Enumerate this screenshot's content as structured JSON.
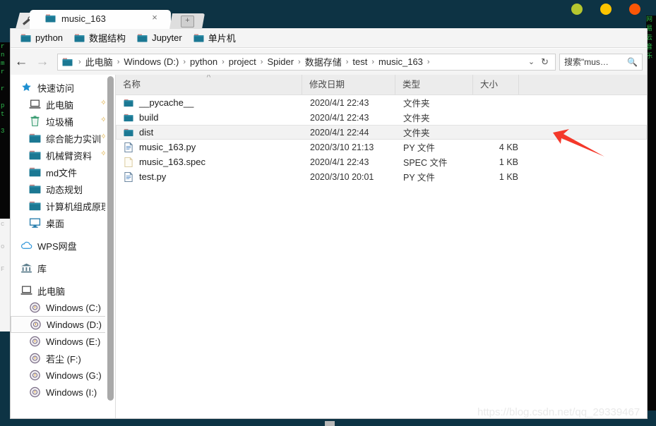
{
  "window": {
    "controls": [
      {
        "name": "minimize",
        "color": "#b5c72f"
      },
      {
        "name": "maximize",
        "color": "#fcc400"
      },
      {
        "name": "close",
        "color": "#fa5607"
      }
    ],
    "background_color": "#0d3344"
  },
  "tabs": {
    "active": {
      "label": "music_163",
      "icon": "folder-icon",
      "close_label": "×"
    },
    "new_tab_label": "+",
    "tool_icon": "wrench-icon"
  },
  "bookmarks": {
    "items": [
      {
        "label": "python",
        "icon": "folder-icon"
      },
      {
        "label": "数据结构",
        "icon": "folder-icon"
      },
      {
        "label": "Jupyter",
        "icon": "folder-icon"
      },
      {
        "label": "单片机",
        "icon": "folder-icon"
      }
    ]
  },
  "navbar": {
    "back_label": "←",
    "forward_label": "→",
    "breadcrumb": [
      "此电脑",
      "Windows (D:)",
      "python",
      "project",
      "Spider",
      "数据存储",
      "test",
      "music_163"
    ],
    "separator": "›",
    "dropdown_label": "⌄",
    "refresh_label": "↻",
    "search": {
      "placeholder": "搜索\"mus…",
      "icon": "search-icon"
    }
  },
  "sidebar": {
    "items": [
      {
        "label": "快速访问",
        "icon": "star-icon",
        "indent": 0,
        "pinned": false,
        "selected": false
      },
      {
        "label": "此电脑",
        "icon": "computer-icon",
        "indent": 1,
        "pinned": true,
        "selected": false
      },
      {
        "label": "垃圾桶",
        "icon": "trash-icon",
        "indent": 1,
        "pinned": true,
        "selected": false
      },
      {
        "label": "综合能力实训",
        "icon": "folder-icon",
        "indent": 1,
        "pinned": true,
        "selected": false
      },
      {
        "label": "机械臂资料",
        "icon": "folder-icon",
        "indent": 1,
        "pinned": true,
        "selected": false
      },
      {
        "label": "md文件",
        "icon": "folder-icon",
        "indent": 1,
        "pinned": false,
        "selected": false
      },
      {
        "label": "动态规划",
        "icon": "folder-icon",
        "indent": 1,
        "pinned": false,
        "selected": false
      },
      {
        "label": "计算机组成原理",
        "icon": "folder-icon",
        "indent": 1,
        "pinned": false,
        "selected": false
      },
      {
        "label": "桌面",
        "icon": "desktop-icon",
        "indent": 1,
        "pinned": false,
        "selected": false
      },
      {
        "label": "WPS网盘",
        "icon": "cloud-icon",
        "indent": 0,
        "pinned": false,
        "selected": false
      },
      {
        "label": "库",
        "icon": "library-icon",
        "indent": 0,
        "pinned": false,
        "selected": false
      },
      {
        "label": "此电脑",
        "icon": "computer-icon",
        "indent": 0,
        "pinned": false,
        "selected": false
      },
      {
        "label": "Windows (C:)",
        "icon": "drive-icon",
        "indent": 1,
        "pinned": false,
        "selected": false
      },
      {
        "label": "Windows (D:)",
        "icon": "drive-icon",
        "indent": 1,
        "pinned": false,
        "selected": true
      },
      {
        "label": "Windows (E:)",
        "icon": "drive-icon",
        "indent": 1,
        "pinned": false,
        "selected": false
      },
      {
        "label": "若尘 (F:)",
        "icon": "drive-icon",
        "indent": 1,
        "pinned": false,
        "selected": false
      },
      {
        "label": "Windows (G:)",
        "icon": "drive-icon",
        "indent": 1,
        "pinned": false,
        "selected": false
      },
      {
        "label": "Windows (I:)",
        "icon": "drive-icon",
        "indent": 1,
        "pinned": false,
        "selected": false
      }
    ]
  },
  "filelist": {
    "columns": [
      {
        "label": "名称",
        "sorted": "asc",
        "sort_glyph": "˄"
      },
      {
        "label": "修改日期",
        "sorted": null
      },
      {
        "label": "类型",
        "sorted": null
      },
      {
        "label": "大小",
        "sorted": null
      }
    ],
    "rows": [
      {
        "name": "__pycache__",
        "date": "2020/4/1 22:43",
        "type": "文件夹",
        "size": "",
        "icon": "folder-icon",
        "hover": false
      },
      {
        "name": "build",
        "date": "2020/4/1 22:43",
        "type": "文件夹",
        "size": "",
        "icon": "folder-icon",
        "hover": false
      },
      {
        "name": "dist",
        "date": "2020/4/1 22:44",
        "type": "文件夹",
        "size": "",
        "icon": "folder-icon",
        "hover": true
      },
      {
        "name": "music_163.py",
        "date": "2020/3/10 21:13",
        "type": "PY 文件",
        "size": "4 KB",
        "icon": "py-file-icon",
        "hover": false
      },
      {
        "name": "music_163.spec",
        "date": "2020/4/1 22:43",
        "type": "SPEC 文件",
        "size": "1 KB",
        "icon": "blank-file-icon",
        "hover": false
      },
      {
        "name": "test.py",
        "date": "2020/3/10 20:01",
        "type": "PY 文件",
        "size": "1 KB",
        "icon": "py-file-icon",
        "hover": false
      }
    ]
  },
  "annotation": {
    "arrow_color": "#f4382a",
    "points_to": "dist"
  },
  "watermark": {
    "text": "https://blog.csdn.net/qq_29339467"
  },
  "background_terminal": {
    "left_text": "r\nn\nm\nr\n\nr\n\np\nt\n\n3",
    "left_lower_text": "c\n\no\n\nF",
    "right_text": "网\n易\n云\n音\n乐"
  }
}
